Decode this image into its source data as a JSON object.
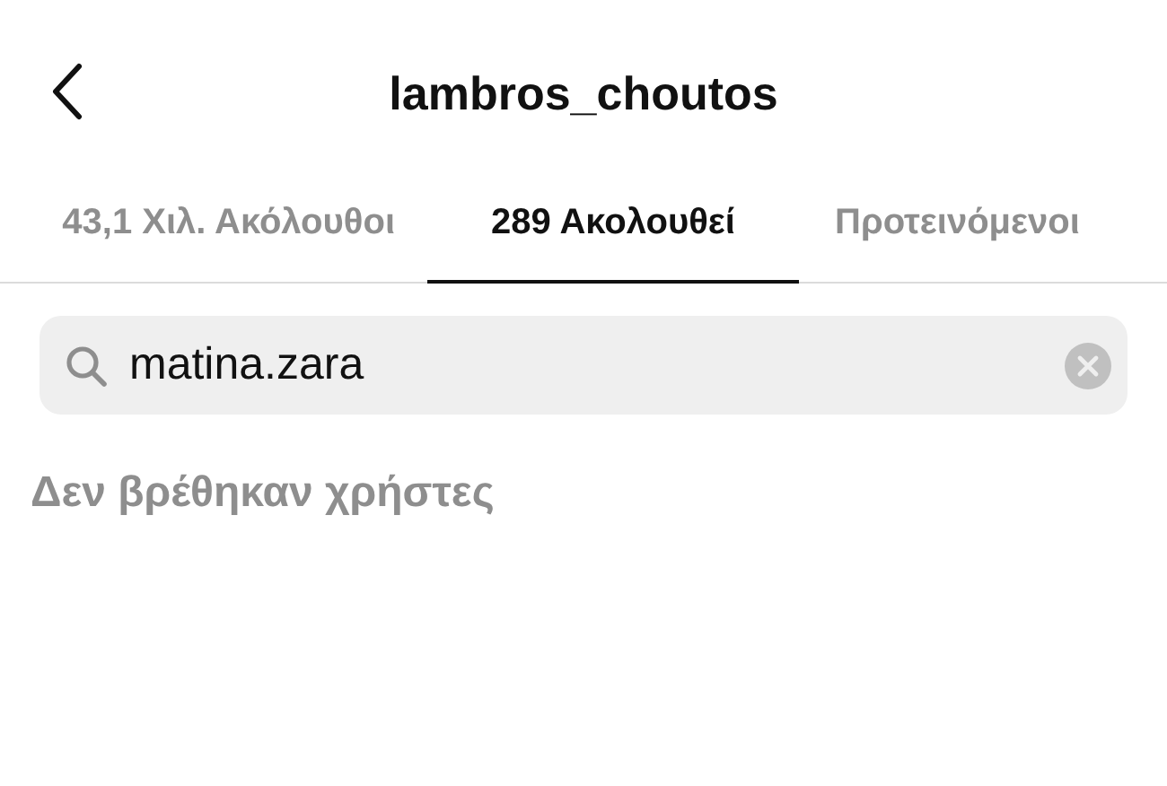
{
  "header": {
    "title": "lambros_choutos"
  },
  "tabs": [
    {
      "label": "43,1 Χιλ. Ακόλουθοι",
      "selected": false
    },
    {
      "label": "289 Ακολουθεί",
      "selected": true
    },
    {
      "label": "Προτεινόμενοι",
      "selected": false
    }
  ],
  "search": {
    "value": "matina.zara"
  },
  "empty_message": "Δεν βρέθηκαν χρήστες"
}
